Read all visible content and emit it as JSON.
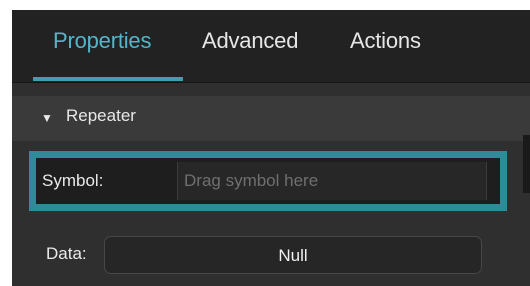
{
  "tabs": [
    {
      "label": "Properties",
      "active": true
    },
    {
      "label": "Advanced",
      "active": false
    },
    {
      "label": "Actions",
      "active": false
    }
  ],
  "section": {
    "toggle_icon": "triangle-down-icon",
    "title": "Repeater",
    "expanded": true
  },
  "symbol": {
    "label": "Symbol:",
    "value": "",
    "placeholder": "Drag symbol here",
    "highlighted": true
  },
  "data_field": {
    "label": "Data:",
    "value": "Null"
  },
  "colors": {
    "accent": "#55b5c8",
    "highlight_border": "#2f8b99",
    "panel_background": "#2f2f2f",
    "tabbar_background": "#222222"
  }
}
